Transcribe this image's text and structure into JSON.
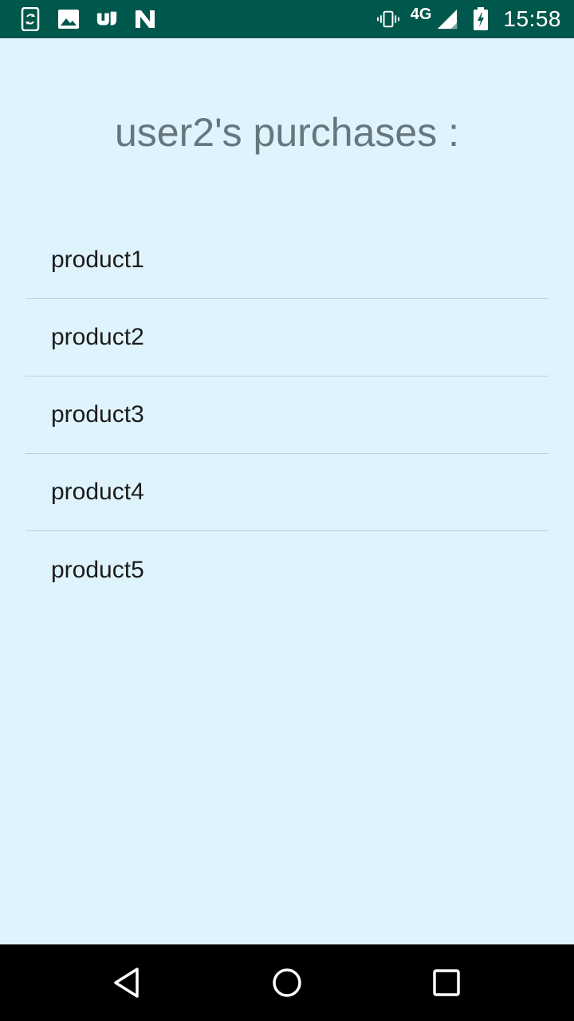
{
  "status_bar": {
    "time": "15:58",
    "network": "4G",
    "left_icons": [
      "phone-sync-icon",
      "image-icon",
      "app-icon",
      "n-icon"
    ],
    "right_icons": [
      "vibrate-icon",
      "signal-icon",
      "battery-charging-icon"
    ]
  },
  "page": {
    "title": "user2's purchases :"
  },
  "products": [
    {
      "label": "product1"
    },
    {
      "label": "product2"
    },
    {
      "label": "product3"
    },
    {
      "label": "product4"
    },
    {
      "label": "product5"
    }
  ],
  "nav_bar": {
    "buttons": [
      "back-icon",
      "home-icon",
      "recents-icon"
    ]
  },
  "colors": {
    "status_bar": "#00574b",
    "background": "#dff3fd",
    "title": "#67767e",
    "divider": "#bfcfd6",
    "nav_bar": "#000000"
  }
}
